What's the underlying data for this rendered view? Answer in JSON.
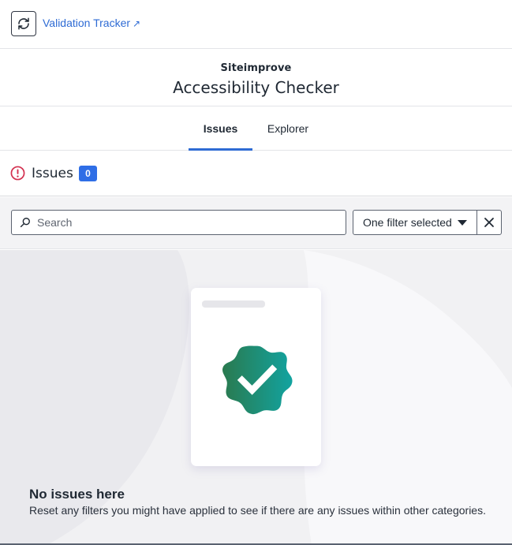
{
  "topbar": {
    "refresh_icon": "refresh-icon",
    "tracker_link_label": "Validation Tracker",
    "external_link_icon": "↗"
  },
  "header": {
    "brand": "Siteimprove",
    "title": "Accessibility Checker"
  },
  "tabs": [
    {
      "label": "Issues",
      "active": true
    },
    {
      "label": "Explorer",
      "active": false
    }
  ],
  "issues_section": {
    "title": "Issues",
    "count": "0",
    "alert_icon": "alert-circle-icon"
  },
  "filters": {
    "search_placeholder": "Search",
    "search_value": "",
    "filter_label": "One filter selected",
    "clear_icon": "close-icon"
  },
  "empty_state": {
    "title": "No issues here",
    "description": "Reset any filters you might have applied to see if there are any issues within other categories."
  },
  "colors": {
    "accent": "#2e6bd4",
    "badge": "#2f6ee6",
    "alert": "#d3304f",
    "check_gradient_start": "#2a7a4f",
    "check_gradient_end": "#12a3a0"
  }
}
